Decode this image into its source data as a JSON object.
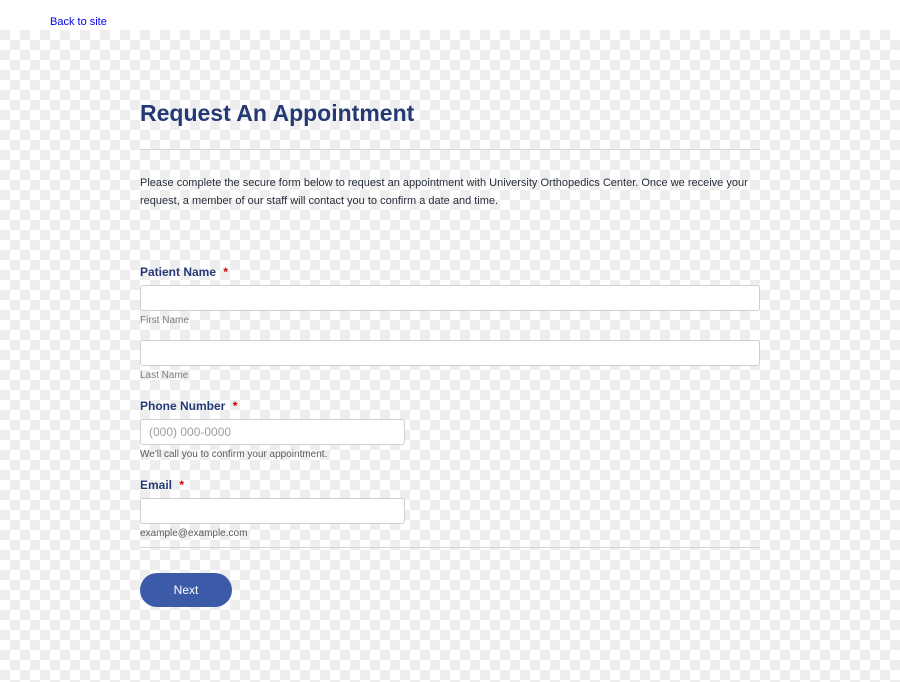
{
  "top": {
    "back_label": "Back to site"
  },
  "header": {
    "title": "Request An Appointment"
  },
  "intro": {
    "text": "Please complete the secure form below to request an appointment with University Orthopedics Center. Once we receive your request, a member of our staff will contact you to confirm a date and time."
  },
  "form": {
    "patient_name": {
      "label": "Patient Name",
      "first_sublabel": "First Name",
      "last_sublabel": "Last Name"
    },
    "phone": {
      "label": "Phone Number",
      "placeholder": "(000) 000-0000",
      "helper": "We'll call you to confirm your appointment."
    },
    "email": {
      "label": "Email",
      "helper": "example@example.com"
    },
    "next_label": "Next"
  }
}
